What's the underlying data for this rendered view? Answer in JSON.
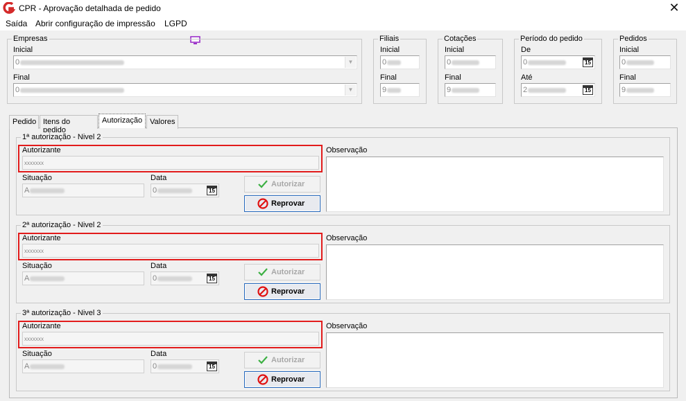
{
  "window": {
    "title": "CPR - Aprovação detalhada de pedido",
    "close_glyph": "✕"
  },
  "menu": {
    "items": [
      "Saída",
      "Abrir configuração de impressão",
      "LGPD"
    ],
    "lgpd_icon": "monitor-icon"
  },
  "filters": {
    "empresas": {
      "legend": "Empresas",
      "inicial_label": "Inicial",
      "inicial_value": "0",
      "final_label": "Final",
      "final_value": "0"
    },
    "filiais": {
      "legend": "Filiais",
      "inicial_label": "Inicial",
      "inicial_value": "0",
      "final_label": "Final",
      "final_value": "9"
    },
    "cotacoes": {
      "legend": "Cotações",
      "inicial_label": "Inicial",
      "inicial_value": "0",
      "final_label": "Final",
      "final_value": "9"
    },
    "periodo": {
      "legend": "Período do pedido",
      "de_label": "De",
      "de_value": "0",
      "ate_label": "Até",
      "ate_value": "2",
      "calendar_glyph": "15"
    },
    "pedidos": {
      "legend": "Pedidos",
      "inicial_label": "Inicial",
      "inicial_value": "0",
      "final_label": "Final",
      "final_value": "9"
    }
  },
  "tabs": [
    "Pedido",
    "Itens do pedido",
    "Autorização",
    "Valores"
  ],
  "active_tab": "Autorização",
  "approvals": [
    {
      "legend": "1ª autorização - Nivel 2",
      "autorizante_label": "Autorizante",
      "autorizante_value": "xxxxxxx",
      "situacao_label": "Situação",
      "situacao_value": "A",
      "data_label": "Data",
      "data_value": "0",
      "observacao_label": "Observação",
      "autorizar_label": "Autorizar",
      "reprovar_label": "Reprovar"
    },
    {
      "legend": "2ª autorização - Nivel 2",
      "autorizante_label": "Autorizante",
      "autorizante_value": "xxxxxxx",
      "situacao_label": "Situação",
      "situacao_value": "A",
      "data_label": "Data",
      "data_value": "0",
      "observacao_label": "Observação",
      "autorizar_label": "Autorizar",
      "reprovar_label": "Reprovar"
    },
    {
      "legend": "3ª autorização - Nivel 3",
      "autorizante_label": "Autorizante",
      "autorizante_value": "xxxxxxx",
      "situacao_label": "Situação",
      "situacao_value": "A",
      "data_label": "Data",
      "data_value": "0",
      "observacao_label": "Observação",
      "autorizar_label": "Autorizar",
      "reprovar_label": "Reprovar"
    }
  ],
  "colors": {
    "highlight": "#e21b1b",
    "accent": "#2266bb",
    "check": "#3cb043",
    "stop": "#e01010",
    "logo": "#d42a2a",
    "lgpd": "#9b30c9"
  }
}
